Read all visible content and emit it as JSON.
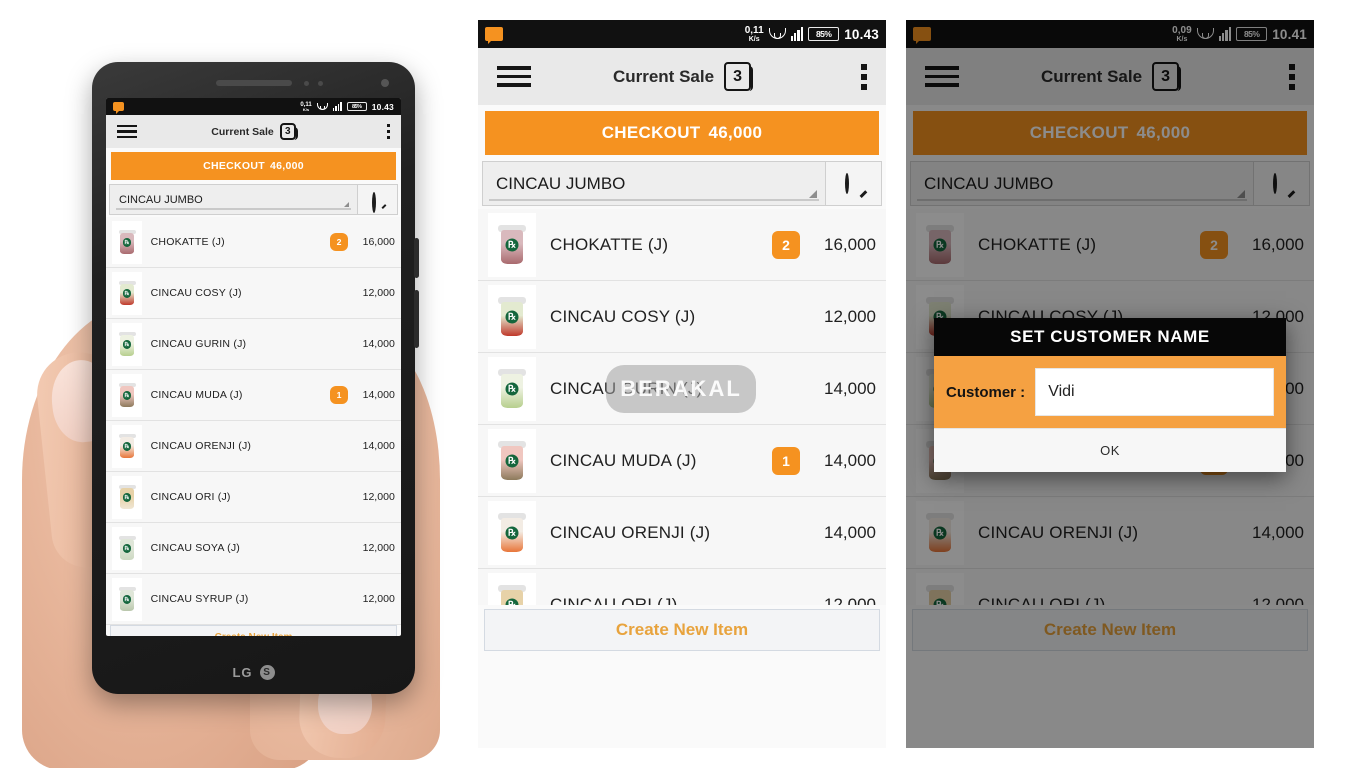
{
  "app": {
    "title": "Current Sale",
    "sale_count": "3",
    "checkout_label": "CHECKOUT",
    "checkout_amount": "46,000",
    "create_new_item": "Create New Item",
    "search_value": "CINCAU JUMBO",
    "search_placeholder": "CINCAU JUMBO",
    "accent_color": "#f59220",
    "appbar_color": "#e9e9e9"
  },
  "status_bar_mid": {
    "data_rate": "0,11",
    "data_unit": "K/s",
    "battery": "85%",
    "time": "10.43",
    "wifi_icon": "wifi-icon",
    "signal_icon": "signal-bars-icon",
    "message_icon": "message-icon"
  },
  "status_bar_left": {
    "data_rate": "0,11",
    "data_unit": "K/s",
    "battery": "85%",
    "time": "10.43"
  },
  "status_bar_right": {
    "data_rate": "0,09",
    "data_unit": "K/s",
    "battery": "85%",
    "time": "10.41",
    "wifi_icon": "wifi-icon",
    "signal_icon": "signal-bars-icon",
    "message_icon": "message-icon"
  },
  "icons": {
    "hamburger": "hamburger-menu-icon",
    "kebab": "overflow-menu-icon",
    "search": "search-icon",
    "dropdown": "dropdown-corner-icon"
  },
  "items": [
    {
      "name": "CHOKATTE (J)",
      "price": "16,000",
      "qty": "2",
      "cup_top": "#d9b9bd",
      "cup_bot": "#a96a6e"
    },
    {
      "name": "CINCAU COSY (J)",
      "price": "12,000",
      "qty": "",
      "cup_top": "#e3ead0",
      "cup_bot": "#c0392b"
    },
    {
      "name": "CINCAU GURIN (J)",
      "price": "14,000",
      "qty": "",
      "cup_top": "#eef2e2",
      "cup_bot": "#b7cf8e"
    },
    {
      "name": "CINCAU MUDA (J)",
      "price": "14,000",
      "qty": "1",
      "cup_top": "#f0c7c0",
      "cup_bot": "#8d7a5c"
    },
    {
      "name": "CINCAU ORENJI (J)",
      "price": "14,000",
      "qty": "",
      "cup_top": "#f3ece4",
      "cup_bot": "#e8763a"
    },
    {
      "name": "CINCAU ORI (J)",
      "price": "12,000",
      "qty": "",
      "cup_top": "#e7d2a8",
      "cup_bot": "#efe6d4"
    },
    {
      "name": "CINCAU SOYA (J)",
      "price": "12,000",
      "qty": "",
      "cup_top": "#dfe6d8",
      "cup_bot": "#cdd8c2"
    },
    {
      "name": "CINCAU SYRUP (J)",
      "price": "12,000",
      "qty": "",
      "cup_top": "#dfe6d8",
      "cup_bot": "#b9c7ac"
    }
  ],
  "watermark": {
    "text": "BERAKAL"
  },
  "dialog": {
    "title": "SET CUSTOMER NAME",
    "label": "Customer :",
    "value": "Vidi",
    "ok_label": "OK"
  },
  "phone": {
    "brand": "LG"
  }
}
